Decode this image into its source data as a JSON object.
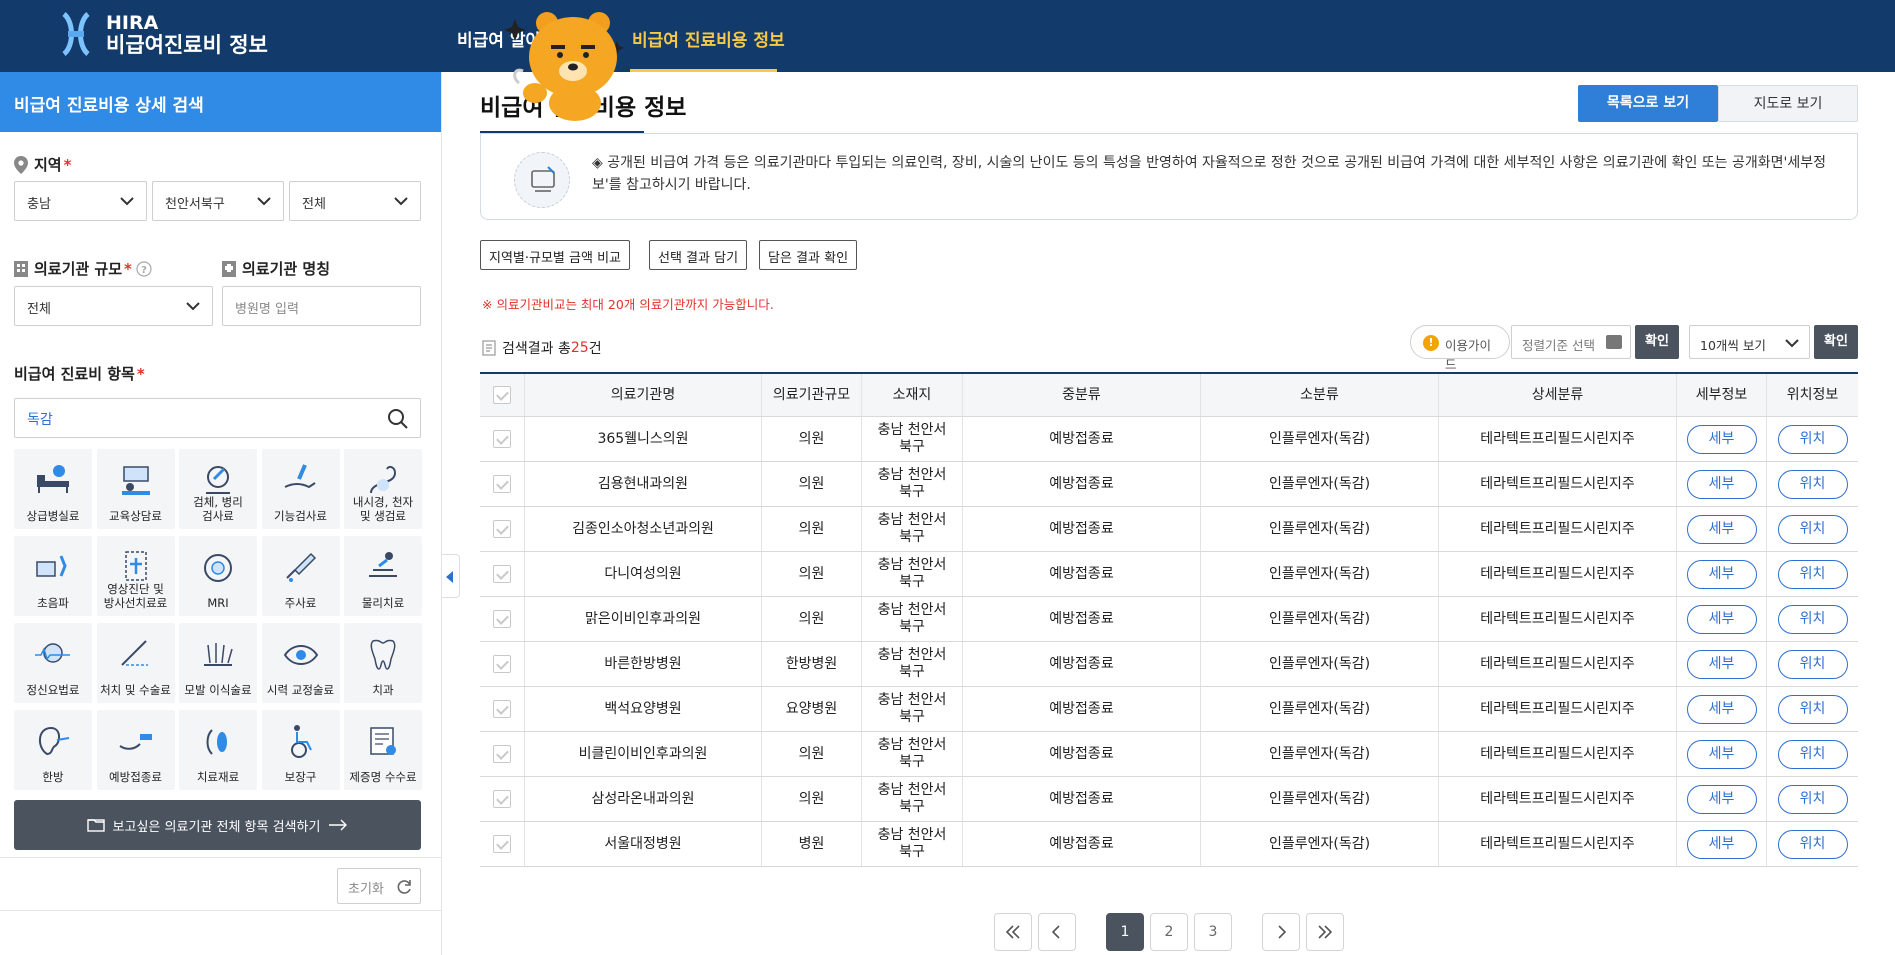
{
  "header": {
    "logo_line1": "HIRA",
    "logo_line2": "비급여진료비 정보",
    "nav": [
      {
        "label": "비급여 알아"
      },
      {
        "label": "비급여 진료비용 정보"
      }
    ]
  },
  "sidebar": {
    "title": "비급여 진료비용 상세 검색",
    "region_label": "지역",
    "region_selects": [
      "충남",
      "천안서북구",
      "전체"
    ],
    "scale_label": "의료기관 규모",
    "scale_value": "전체",
    "name_label": "의료기관 명칭",
    "name_placeholder": "병원명 입력",
    "item_label": "비급여 진료비 항목",
    "search_value": "독감",
    "categories": [
      {
        "label": "상급병실료",
        "icon": "bed-icon"
      },
      {
        "label": "교육상담료",
        "icon": "counseling-icon"
      },
      {
        "label": "검체, 병리\n검사료",
        "icon": "microscope-icon"
      },
      {
        "label": "기능검사료",
        "icon": "hand-test-icon"
      },
      {
        "label": "내시경, 천자\n및 생검료",
        "icon": "endoscope-icon"
      },
      {
        "label": "초음파",
        "icon": "ultrasound-icon"
      },
      {
        "label": "영상진단 및\n방사선치료료",
        "icon": "radiology-icon"
      },
      {
        "label": "MRI",
        "icon": "mri-icon"
      },
      {
        "label": "주사료",
        "icon": "syringe-icon"
      },
      {
        "label": "물리치료",
        "icon": "physio-icon"
      },
      {
        "label": "정신요법료",
        "icon": "brain-wave-icon"
      },
      {
        "label": "처치 및 수술료",
        "icon": "surgery-icon"
      },
      {
        "label": "모발 이식술료",
        "icon": "hair-icon"
      },
      {
        "label": "시력 교정술료",
        "icon": "eye-icon"
      },
      {
        "label": "치과",
        "icon": "tooth-icon"
      },
      {
        "label": "한방",
        "icon": "ear-acupuncture-icon"
      },
      {
        "label": "예방접종료",
        "icon": "vaccine-icon"
      },
      {
        "label": "치료재료",
        "icon": "material-icon"
      },
      {
        "label": "보장구",
        "icon": "wheelchair-icon"
      },
      {
        "label": "제증명 수수료",
        "icon": "certificate-icon"
      }
    ],
    "all_search_label": "보고싶은 의료기관 전체 항목 검색하기",
    "reset_label": "초기화"
  },
  "main": {
    "title": "비급여 진료비용 정보",
    "view_list": "목록으로 보기",
    "view_map": "지도로 보기",
    "notice": "◈ 공개된 비급여 가격 등은 의료기관마다 투입되는 의료인력, 장비, 시술의 난이도 등의 특성을 반영하여 자율적으로 정한 것으로 공개된 비급여 가격에 대한 세부적인 사항은 의료기관에 확인 또는 공개화면'세부정보'를 참고하시기 바랍니다.",
    "tools": [
      "지역별·규모별 금액 비교",
      "선택 결과 담기",
      "담은 결과 확인"
    ],
    "warning": "※ 의료기관비교는 최대 20개 의료기관까지 가능합니다.",
    "result_prefix": "검색결과 총",
    "result_count": "25",
    "result_suffix": "건",
    "guide_label": "이용가이드",
    "sort_placeholder": "정렬기준 선택",
    "confirm_label": "확인",
    "per_page": "10개씩 보기",
    "columns": [
      "의료기관명",
      "의료기관규모",
      "소재지",
      "중분류",
      "소분류",
      "상세분류",
      "세부정보",
      "위치정보"
    ],
    "detail_btn": "세부",
    "location_btn": "위치",
    "rows": [
      {
        "name": "365웰니스의원",
        "scale": "의원",
        "loc": "충남 천안서\n북구",
        "mid": "예방접종료",
        "sub": "인플루엔자(독감)",
        "det": "테라텍트프리필드시린지주"
      },
      {
        "name": "김용현내과의원",
        "scale": "의원",
        "loc": "충남 천안서\n북구",
        "mid": "예방접종료",
        "sub": "인플루엔자(독감)",
        "det": "테라텍트프리필드시린지주"
      },
      {
        "name": "김종인소아청소년과의원",
        "scale": "의원",
        "loc": "충남 천안서\n북구",
        "mid": "예방접종료",
        "sub": "인플루엔자(독감)",
        "det": "테라텍트프리필드시린지주"
      },
      {
        "name": "다니여성의원",
        "scale": "의원",
        "loc": "충남 천안서\n북구",
        "mid": "예방접종료",
        "sub": "인플루엔자(독감)",
        "det": "테라텍트프리필드시린지주"
      },
      {
        "name": "맑은이비인후과의원",
        "scale": "의원",
        "loc": "충남 천안서\n북구",
        "mid": "예방접종료",
        "sub": "인플루엔자(독감)",
        "det": "테라텍트프리필드시린지주"
      },
      {
        "name": "바른한방병원",
        "scale": "한방병원",
        "loc": "충남 천안서\n북구",
        "mid": "예방접종료",
        "sub": "인플루엔자(독감)",
        "det": "테라텍트프리필드시린지주"
      },
      {
        "name": "백석요양병원",
        "scale": "요양병원",
        "loc": "충남 천안서\n북구",
        "mid": "예방접종료",
        "sub": "인플루엔자(독감)",
        "det": "테라텍트프리필드시린지주"
      },
      {
        "name": "비클린이비인후과의원",
        "scale": "의원",
        "loc": "충남 천안서\n북구",
        "mid": "예방접종료",
        "sub": "인플루엔자(독감)",
        "det": "테라텍트프리필드시린지주"
      },
      {
        "name": "삼성라온내과의원",
        "scale": "의원",
        "loc": "충남 천안서\n북구",
        "mid": "예방접종료",
        "sub": "인플루엔자(독감)",
        "det": "테라텍트프리필드시린지주"
      },
      {
        "name": "서울대정병원",
        "scale": "병원",
        "loc": "충남 천안서\n북구",
        "mid": "예방접종료",
        "sub": "인플루엔자(독감)",
        "det": "테라텍트프리필드시린지주"
      }
    ],
    "pagination": {
      "pages": [
        "1",
        "2",
        "3"
      ],
      "current": "1"
    }
  },
  "colors": {
    "header": "#123a6b",
    "accent": "#2f8be6",
    "nav_active": "#f7c948",
    "danger": "#e0312b",
    "dark_button": "#4b535f"
  }
}
